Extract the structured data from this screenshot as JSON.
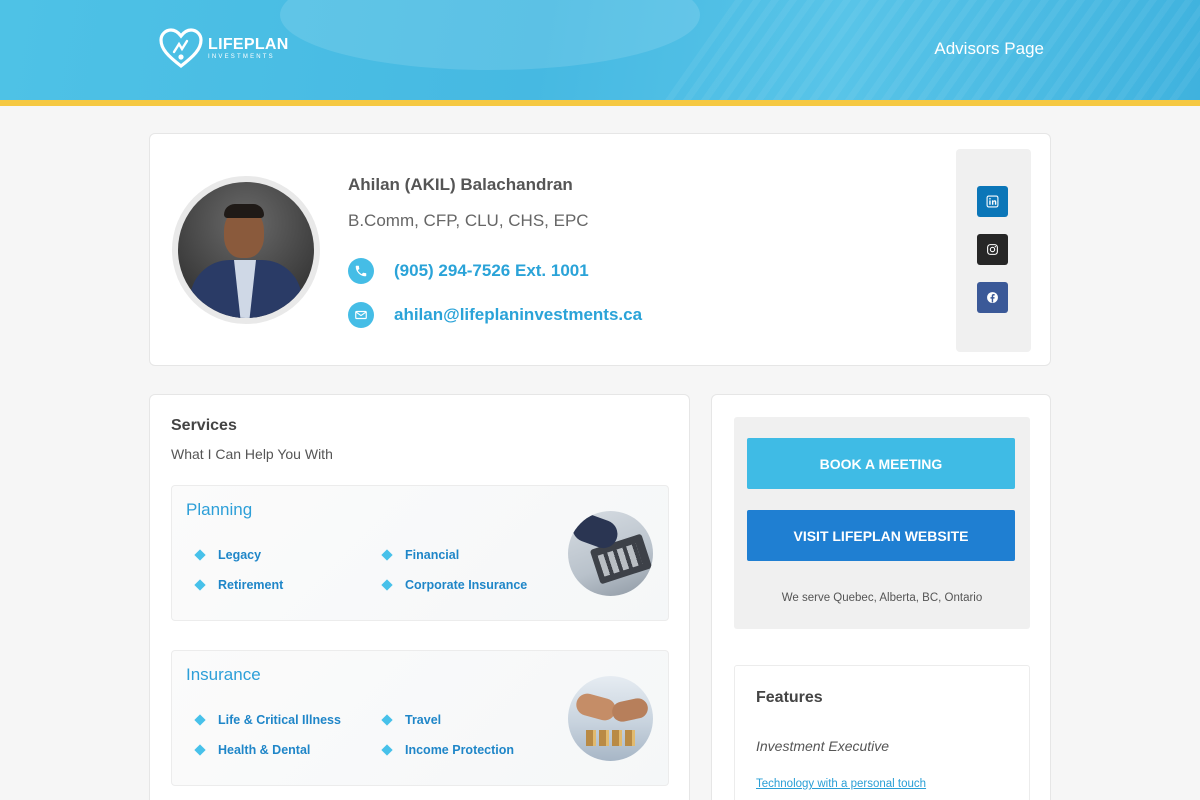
{
  "header": {
    "logo_text": "LIFEPLAN",
    "logo_subtext": "INVESTMENTS",
    "nav_label": "Advisors Page",
    "stripe_color": "#f5c842"
  },
  "profile": {
    "name": "Ahilan (AKIL) Balachandran",
    "credentials": "B.Comm, CFP, CLU, CHS, EPC",
    "phone": "(905) 294-7526 Ext. 1001",
    "email": "ahilan@lifeplaninvestments.ca",
    "accent_color": "#2aa3d8",
    "social": [
      {
        "name": "linkedin",
        "icon": "linkedin-icon",
        "color": "#0b76b8"
      },
      {
        "name": "instagram",
        "icon": "instagram-icon",
        "color": "#262626"
      },
      {
        "name": "facebook",
        "icon": "facebook-icon",
        "color": "#3b5998"
      }
    ]
  },
  "services": {
    "title": "Services",
    "subtitle": "What I Can Help You With",
    "groups": [
      {
        "heading": "Planning",
        "items": [
          "Legacy",
          "Financial",
          "Retirement",
          "Corporate Insurance"
        ]
      },
      {
        "heading": "Insurance",
        "items": [
          "Life & Critical Illness",
          "Travel",
          "Health & Dental",
          "Income Protection"
        ]
      }
    ]
  },
  "sidebar": {
    "book_label": "BOOK A MEETING",
    "visit_label": "VISIT LIFEPLAN WEBSITE",
    "serve_text": "We serve Quebec, Alberta, BC, Ontario",
    "book_color": "#3fbbe5",
    "visit_color": "#1f7fd2"
  },
  "features": {
    "title": "Features",
    "role": "Investment Executive",
    "link_text": "Technology with a personal touch"
  }
}
